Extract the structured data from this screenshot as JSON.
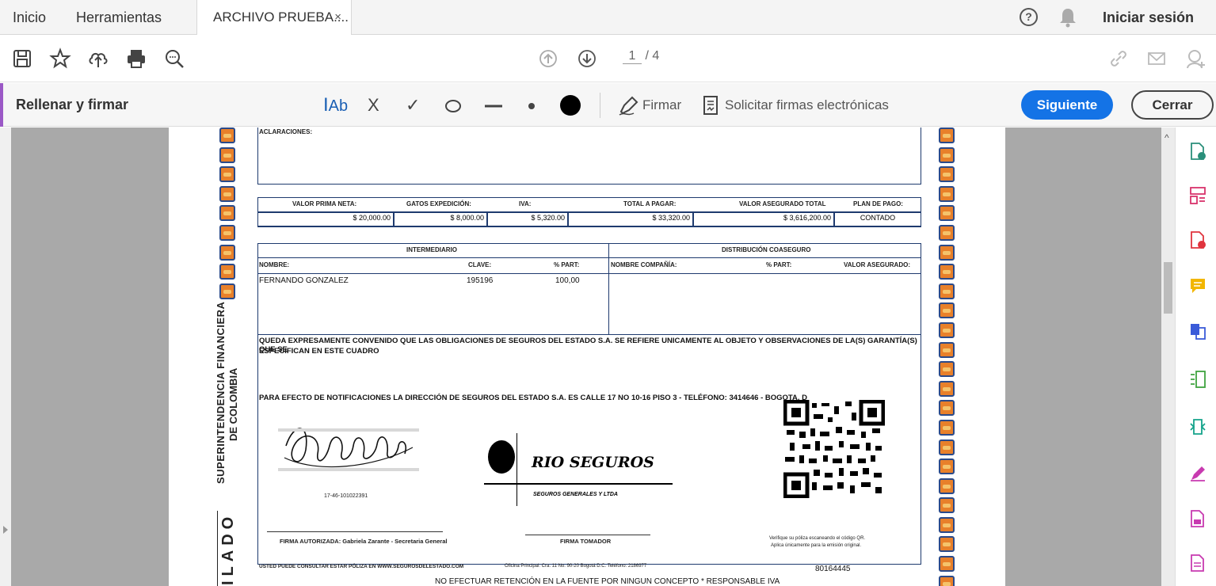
{
  "tabs": {
    "home": "Inicio",
    "tools": "Herramientas",
    "document": "ARCHIVO PRUEBA....",
    "close_glyph": "×"
  },
  "header": {
    "help_glyph": "?",
    "signin": "Iniciar sesión"
  },
  "pagination": {
    "current": "1",
    "total": "/ 4"
  },
  "fill_sign": {
    "title": "Rellenar y firmar",
    "text_tool": "Ab",
    "cross": "X",
    "check": "✓",
    "firmar": "Firmar",
    "solicitar": "Solicitar firmas electrónicas",
    "next": "Siguiente",
    "close": "Cerrar"
  },
  "document": {
    "aclaraciones": "ACLARACIONES:",
    "headers": [
      "VALOR PRIMA NETA:",
      "GATOS EXPEDICIÓN:",
      "IVA:",
      "TOTAL A PAGAR:",
      "VALOR ASEGURADO TOTAL",
      "PLAN DE PAGO:"
    ],
    "values": [
      "$ 20,000.00",
      "$ 8,000.00",
      "$ 5,320.00",
      "$ 33,320.00",
      "$ 3,616,200.00",
      "CONTADO"
    ],
    "intermediario": "INTERMEDIARIO",
    "coaseguro": "DISTRIBUCIÓN COASEGURO",
    "nombre": "NOMBRE:",
    "clave": "CLAVE:",
    "part": "% PART:",
    "nombre_compania": "NOMBRE COMPAÑÍA:",
    "part2": "% PART:",
    "valor_asegurado": "VALOR ASEGURADO:",
    "intermediario_name": "FERNANDO GONZALEZ",
    "intermediario_clave": "195196",
    "intermediario_part": "100,00",
    "clause_1": "QUEDA EXPRESAMENTE CONVENIDO QUE LAS OBLIGACIONES DE SEGUROS DEL ESTADO S.A. SE REFIERE UNICAMENTE AL OBJETO Y OBSERVACIONES DE LA(S) GARANTÍA(S) QUE SE",
    "clause_2": "ESPECIFICAN EN ESTE CUADRO",
    "notificaciones": "PARA EFECTO DE NOTIFICACIONES LA DIRECCIÓN DE SEGUROS DEL ESTADO S.A. ES  CALLE 17 NO 10-16 PISO 3 - TELÉFONO: 3414646 - BOGOTA, D",
    "sig_code": "17-46-101022391",
    "company_logo": "RIO SEGUROS",
    "company_sub": "SEGUROS GENERALES Y LTDA",
    "firma_autorizada": "FIRMA AUTORIZADA: Gabriela Zarante - Secretaria General",
    "firma_tomador": "FIRMA TOMADOR",
    "verify_1": "Verifique su póliza escaneando el código QR.",
    "verify_2": "Aplica únicamente para la emisión original.",
    "footer_left": "USTED PUEDE CONSULTAR ESTAR PÓLIZA EN WWW.SEGUROSDELESTADO.COM",
    "footer_office": "Oficina Principal: Cra. 11 No. 90-20 Bogotá D.C. Teléfono: 2186977",
    "footer_number": "80164445",
    "footer_bottom": "NO EFECTUAR RETENCIÓN EN LA FUENTE POR NINGUN CONCEPTO * RESPONSABLE IVA",
    "vertical_1": "SUPERINTENDENCIA FINANCIERA",
    "vertical_2": "DE COLOMBIA",
    "vertical_big": "ILADO"
  }
}
